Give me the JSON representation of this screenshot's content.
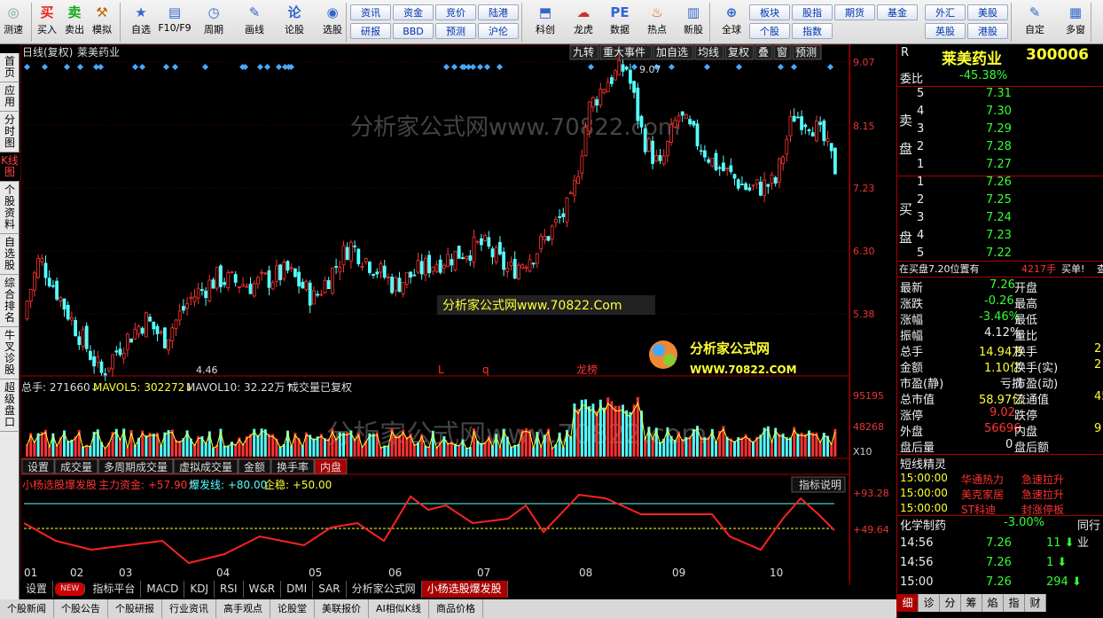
{
  "toolbar": {
    "buttons": [
      "测速",
      "买入",
      "卖出",
      "模拟",
      "自选",
      "F10/F9",
      "周期",
      "画线",
      "论股",
      "选股",
      "科创",
      "龙虎",
      "数据",
      "热点",
      "新股",
      "全球",
      "自定",
      "多窗"
    ],
    "quick": [
      "资讯",
      "资金",
      "竞价",
      "陆港",
      "研报",
      "BBD",
      "预测",
      "沪伦",
      "板块",
      "股指",
      "期权",
      "债券",
      "英股",
      "港股",
      "个股",
      "指数",
      "期货",
      "基金",
      "外汇",
      "美股"
    ]
  },
  "left_nav": [
    "首页",
    "应用",
    "分时图",
    "K线图",
    "个股资料",
    "自选股",
    "综合排名",
    "牛叉诊股",
    "超级盘口"
  ],
  "chart_header": {
    "title": "日线(复权)",
    "stock": "莱美药业",
    "buttons": [
      "九转",
      "重大事件",
      "加自选",
      "均线",
      "复权",
      "叠",
      "窗",
      "预测"
    ]
  },
  "price_axis": [
    "9.07",
    "8.15",
    "7.23",
    "6.30",
    "5.38"
  ],
  "annotations": {
    "high": "9.07",
    "low": "4.46",
    "marks": [
      "L",
      "q",
      "龙榜"
    ]
  },
  "watermark": "分析家公式网www.70822.com",
  "watermark2": "分析家公式网www.70822.Com",
  "logo": "分析家公式网",
  "logo_url": "WWW.70822.COM",
  "vol_header": {
    "total": "总手: 271660↓",
    "ma5": "MAVOL5: 302272↓",
    "ma10": "MAVOL10: 32.22万↑",
    "note": "成交量已复权"
  },
  "vol_axis": [
    "95195",
    "48268",
    "X10"
  ],
  "vol_tabs": [
    "设置",
    "成交量",
    "多周期成交量",
    "虚拟成交量",
    "金额",
    "换手率",
    "内盘"
  ],
  "ind_header": {
    "name": "小杨选股爆发股",
    "main": "主力资金: +57.90↑",
    "burst": "爆发线: +80.00",
    "stable": "企稳: +50.00",
    "explain": "指标说明"
  },
  "ind_axis": [
    "+93.28",
    "+49.64"
  ],
  "months": [
    "01",
    "02",
    "03",
    "04",
    "05",
    "06",
    "07",
    "08",
    "09",
    "10"
  ],
  "bottom_tabs": [
    "设置",
    "NEW",
    "指标平台",
    "MACD",
    "KDJ",
    "RSI",
    "W&R",
    "DMI",
    "SAR",
    "分析家公式网",
    "小杨选股爆发股"
  ],
  "status_tabs": [
    "个股新闻",
    "个股公告",
    "个股研报",
    "行业资讯",
    "高手观点",
    "论股堂",
    "美联报价",
    "AI相似K线",
    "商品价格"
  ],
  "quote": {
    "code_letter": "R",
    "name": "莱美药业",
    "code": "300006",
    "weibi_label": "委比",
    "weibi": "-45.38%",
    "sell_label": "卖盘",
    "buy_label": "买盘",
    "sell": [
      [
        "5",
        "7.31"
      ],
      [
        "4",
        "7.30"
      ],
      [
        "3",
        "7.29"
      ],
      [
        "2",
        "7.28"
      ],
      [
        "1",
        "7.27"
      ]
    ],
    "buy": [
      [
        "1",
        "7.26"
      ],
      [
        "2",
        "7.25"
      ],
      [
        "3",
        "7.24"
      ],
      [
        "4",
        "7.23"
      ],
      [
        "5",
        "7.22"
      ]
    ],
    "notice": "在买盘7.20位置有",
    "notice_vol": "4217手",
    "notice_tail": "买单!",
    "notice_btn": "查",
    "stats": [
      [
        "最新",
        "7.26",
        "开盘",
        ""
      ],
      [
        "涨跌",
        "-0.26",
        "最高",
        ""
      ],
      [
        "涨幅",
        "-3.46%",
        "最低",
        ""
      ],
      [
        "振幅",
        "4.12%",
        "量比",
        ""
      ],
      [
        "总手",
        "14.94万",
        "换手",
        "2"
      ],
      [
        "金额",
        "1.10亿",
        "换手(实)",
        "2"
      ],
      [
        "市盈(静)",
        "亏损",
        "市盈(动)",
        ""
      ],
      [
        "总市值",
        "58.97亿",
        "流通值",
        "45"
      ],
      [
        "涨停",
        "9.02",
        "跌停",
        ""
      ],
      [
        "外盘",
        "56696",
        "内盘",
        "9"
      ],
      [
        "盘后量",
        "0",
        "盘后额",
        ""
      ]
    ],
    "sprite_title": "短线精灵",
    "sprites": [
      [
        "15:00:00",
        "华通热力",
        "急速拉升"
      ],
      [
        "15:00:00",
        "美克家居",
        "急速拉升"
      ],
      [
        "15:00:00",
        "ST科迪",
        "封涨停板"
      ]
    ],
    "sector": "化学制药",
    "sector_chg": "-3.00%",
    "sector_btn": "同行业",
    "ticks": [
      [
        "14:56",
        "7.26",
        "11"
      ],
      [
        "14:56",
        "7.26",
        "1"
      ],
      [
        "15:00",
        "7.26",
        "294"
      ]
    ],
    "rtabs": [
      "细",
      "诊",
      "分",
      "筹",
      "焰",
      "指",
      "财"
    ]
  }
}
